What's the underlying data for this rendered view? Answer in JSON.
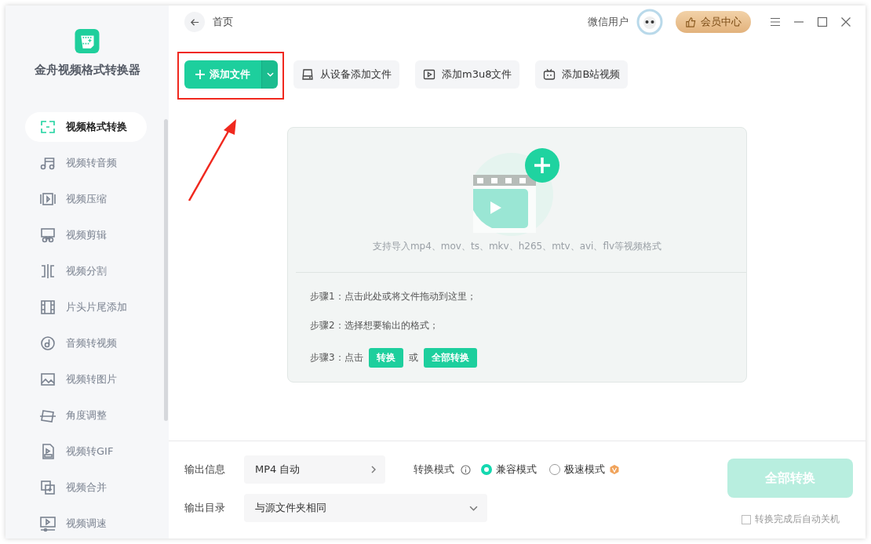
{
  "app": {
    "name": "金舟视频格式转换器"
  },
  "sidebar": {
    "items": [
      {
        "label": "视频格式转换",
        "selected": true
      },
      {
        "label": "视频转音频",
        "selected": false
      },
      {
        "label": "视频压缩",
        "selected": false
      },
      {
        "label": "视频剪辑",
        "selected": false
      },
      {
        "label": "视频分割",
        "selected": false
      },
      {
        "label": "片头片尾添加",
        "selected": false
      },
      {
        "label": "音频转视频",
        "selected": false
      },
      {
        "label": "视频转图片",
        "selected": false
      },
      {
        "label": "角度调整",
        "selected": false
      },
      {
        "label": "视频转GIF",
        "selected": false
      },
      {
        "label": "视频合并",
        "selected": false
      },
      {
        "label": "视频调速",
        "selected": false
      }
    ]
  },
  "header": {
    "page_title": "首页",
    "user_name": "微信用户",
    "vip_button": "会员中心"
  },
  "toolbar": {
    "add_file": "添加文件",
    "buttons": [
      {
        "kind": "device",
        "label": "从设备添加文件"
      },
      {
        "kind": "m3u8",
        "label": "添加m3u8文件"
      },
      {
        "kind": "bilibili",
        "label": "添加B站视频"
      }
    ]
  },
  "drop_area": {
    "formats_text": "支持导入mp4、mov、ts、mkv、h265、mtv、avi、flv等视频格式",
    "step1": "步骤1：点击此处或将文件拖动到这里；",
    "step2": "步骤2：选择想要输出的格式；",
    "step3_prefix": "步骤3：点击",
    "step3_button1": "转换",
    "step3_or": "或",
    "step3_button2": "全部转换"
  },
  "output": {
    "info_label": "输出信息",
    "format_value": "MP4 自动",
    "mode_label": "转换模式",
    "modes": [
      {
        "label": "兼容模式",
        "selected": true,
        "vip": false
      },
      {
        "label": "极速模式",
        "selected": false,
        "vip": true
      }
    ],
    "dir_label": "输出目录",
    "dir_value": "与源文件夹相同",
    "convert_all": {
      "label": "全部转换",
      "disabled": true
    },
    "shutdown": {
      "label": "转换完成后自动关机",
      "checked": false
    }
  },
  "annotation": {
    "highlight_box": true,
    "arrow": true
  }
}
